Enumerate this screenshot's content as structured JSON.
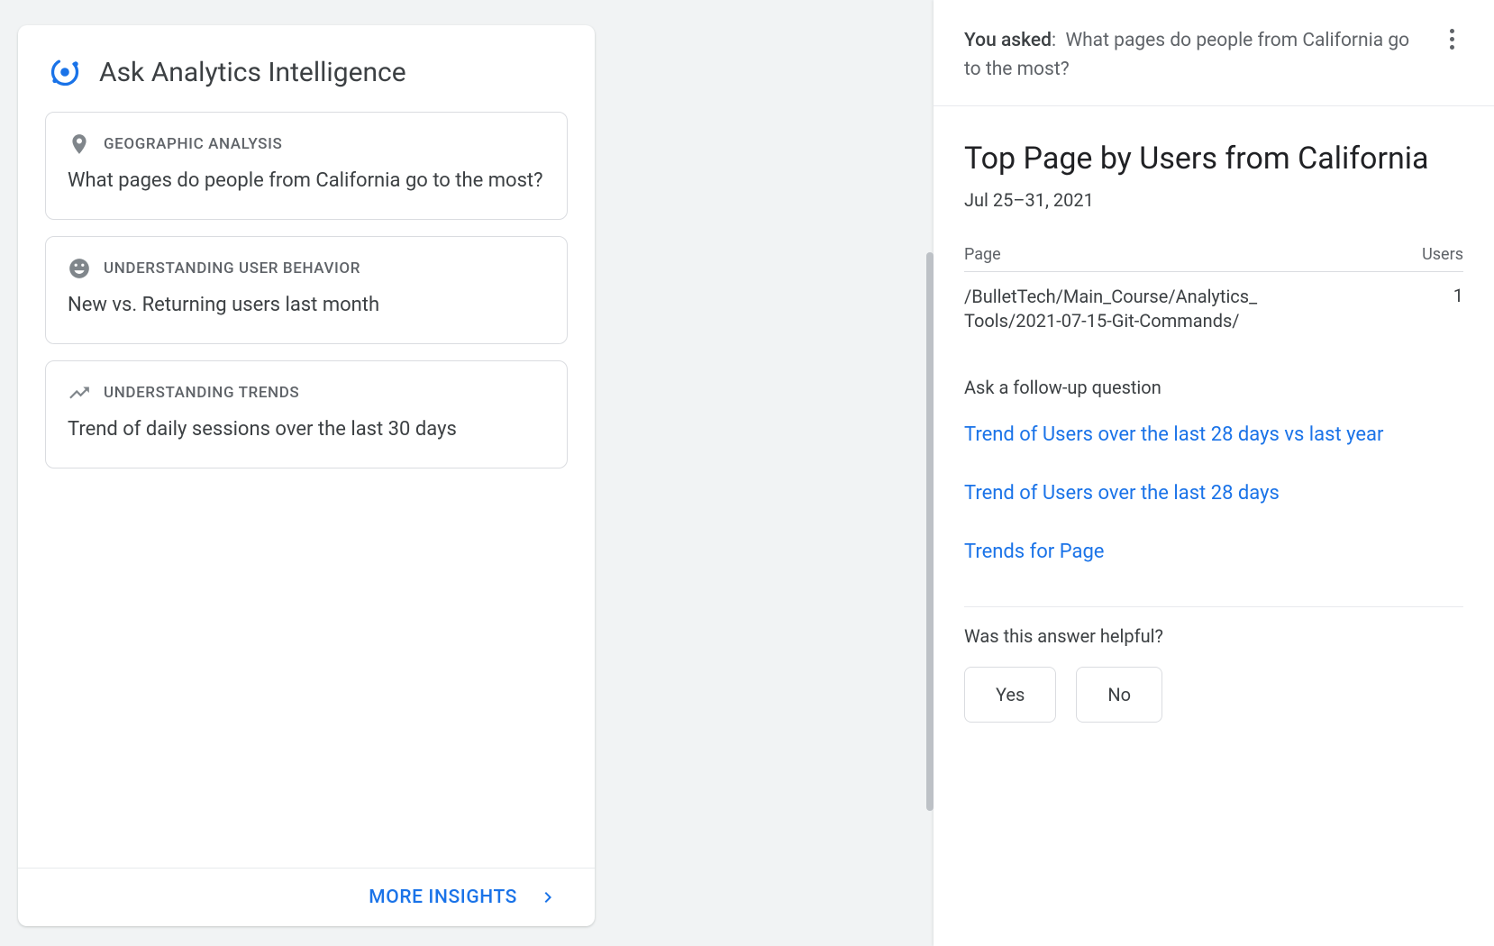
{
  "insights": {
    "title": "Ask Analytics Intelligence",
    "suggestions": [
      {
        "category": "GEOGRAPHIC ANALYSIS",
        "question": "What pages do people from California go to the most?",
        "icon": "pin"
      },
      {
        "category": "UNDERSTANDING USER BEHAVIOR",
        "question": "New vs. Returning users last month",
        "icon": "face"
      },
      {
        "category": "UNDERSTANDING TRENDS",
        "question": "Trend of daily sessions over the last 30 days",
        "icon": "trend"
      }
    ],
    "more_label": "MORE INSIGHTS"
  },
  "answer": {
    "asked_prefix": "You asked",
    "asked_question": "What pages do people from California go to the most?",
    "title": "Top Page by Users from California",
    "date_range": "Jul 25–31, 2021",
    "table": {
      "col_page": "Page",
      "col_users": "Users",
      "rows": [
        {
          "page": "/BulletTech/Main_Course/Analytics_Tools/2021-07-15-Git-Commands/",
          "users": "1"
        }
      ]
    },
    "followup_label": "Ask a follow-up question",
    "followups": [
      "Trend of Users over the last 28 days vs last year",
      "Trend of Users over the last 28 days",
      "Trends for Page"
    ],
    "helpful_label": "Was this answer helpful?",
    "yes_label": "Yes",
    "no_label": "No"
  }
}
